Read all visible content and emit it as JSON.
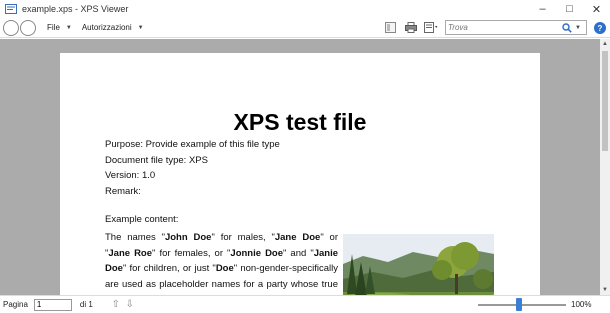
{
  "window": {
    "title": "example.xps - XPS Viewer",
    "controls": {
      "minimize": "–",
      "maximize": "□",
      "close": "✕"
    }
  },
  "toolbar": {
    "menus": [
      "File",
      "Autorizzazioni"
    ],
    "search_placeholder": "Trova",
    "help_label": "?"
  },
  "document": {
    "title": "XPS test file",
    "meta": [
      "Purpose: Provide example of this file type",
      "Document file type: XPS",
      "Version: 1.0",
      "Remark:"
    ],
    "example_label": "Example content:",
    "paragraph": [
      {
        "t": "The names \"",
        "b": false
      },
      {
        "t": "John Doe",
        "b": true
      },
      {
        "t": "\" for males, \"",
        "b": false
      },
      {
        "t": "Jane Doe",
        "b": true
      },
      {
        "t": "\" or \"",
        "b": false
      },
      {
        "t": "Jane Roe",
        "b": true
      },
      {
        "t": "\" for females, or \"",
        "b": false
      },
      {
        "t": "Jonnie Doe",
        "b": true
      },
      {
        "t": "\" and \"",
        "b": false
      },
      {
        "t": "Janie Doe",
        "b": true
      },
      {
        "t": "\" for children, or just \"",
        "b": false
      },
      {
        "t": "Doe",
        "b": true
      },
      {
        "t": "\" non-gender-specifically are used as placeholder names for a party whose true identity is un-known or must be withheld in a legal action, case, or dis",
        "b": false
      }
    ]
  },
  "status": {
    "page_label": "Pagina",
    "page_value": "1",
    "page_of": "di 1",
    "zoom": "100%",
    "zoom_level_fraction": 0.47
  }
}
